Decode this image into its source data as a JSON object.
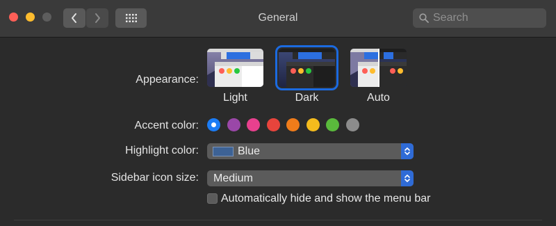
{
  "window": {
    "title": "General"
  },
  "toolbar": {
    "back_icon": "chevron-left-icon",
    "forward_icon": "chevron-right-icon",
    "grid_icon": "grid-icon",
    "search_placeholder": "Search"
  },
  "appearance": {
    "label": "Appearance:",
    "selected": "Dark",
    "options": [
      {
        "name": "Light"
      },
      {
        "name": "Dark"
      },
      {
        "name": "Auto"
      }
    ]
  },
  "accent": {
    "label": "Accent color:",
    "selected": "Blue",
    "colors": [
      "#1b7cf5",
      "#9a47a8",
      "#e8408e",
      "#e8443c",
      "#f07c1a",
      "#f4bb1d",
      "#5aba3c",
      "#8c8c8c"
    ]
  },
  "highlight": {
    "label": "Highlight color:",
    "value": "Blue",
    "chip_color": "#3d6295"
  },
  "sidebar_size": {
    "label": "Sidebar icon size:",
    "value": "Medium"
  },
  "menubar": {
    "label": "Automatically hide and show the menu bar",
    "checked": false
  }
}
